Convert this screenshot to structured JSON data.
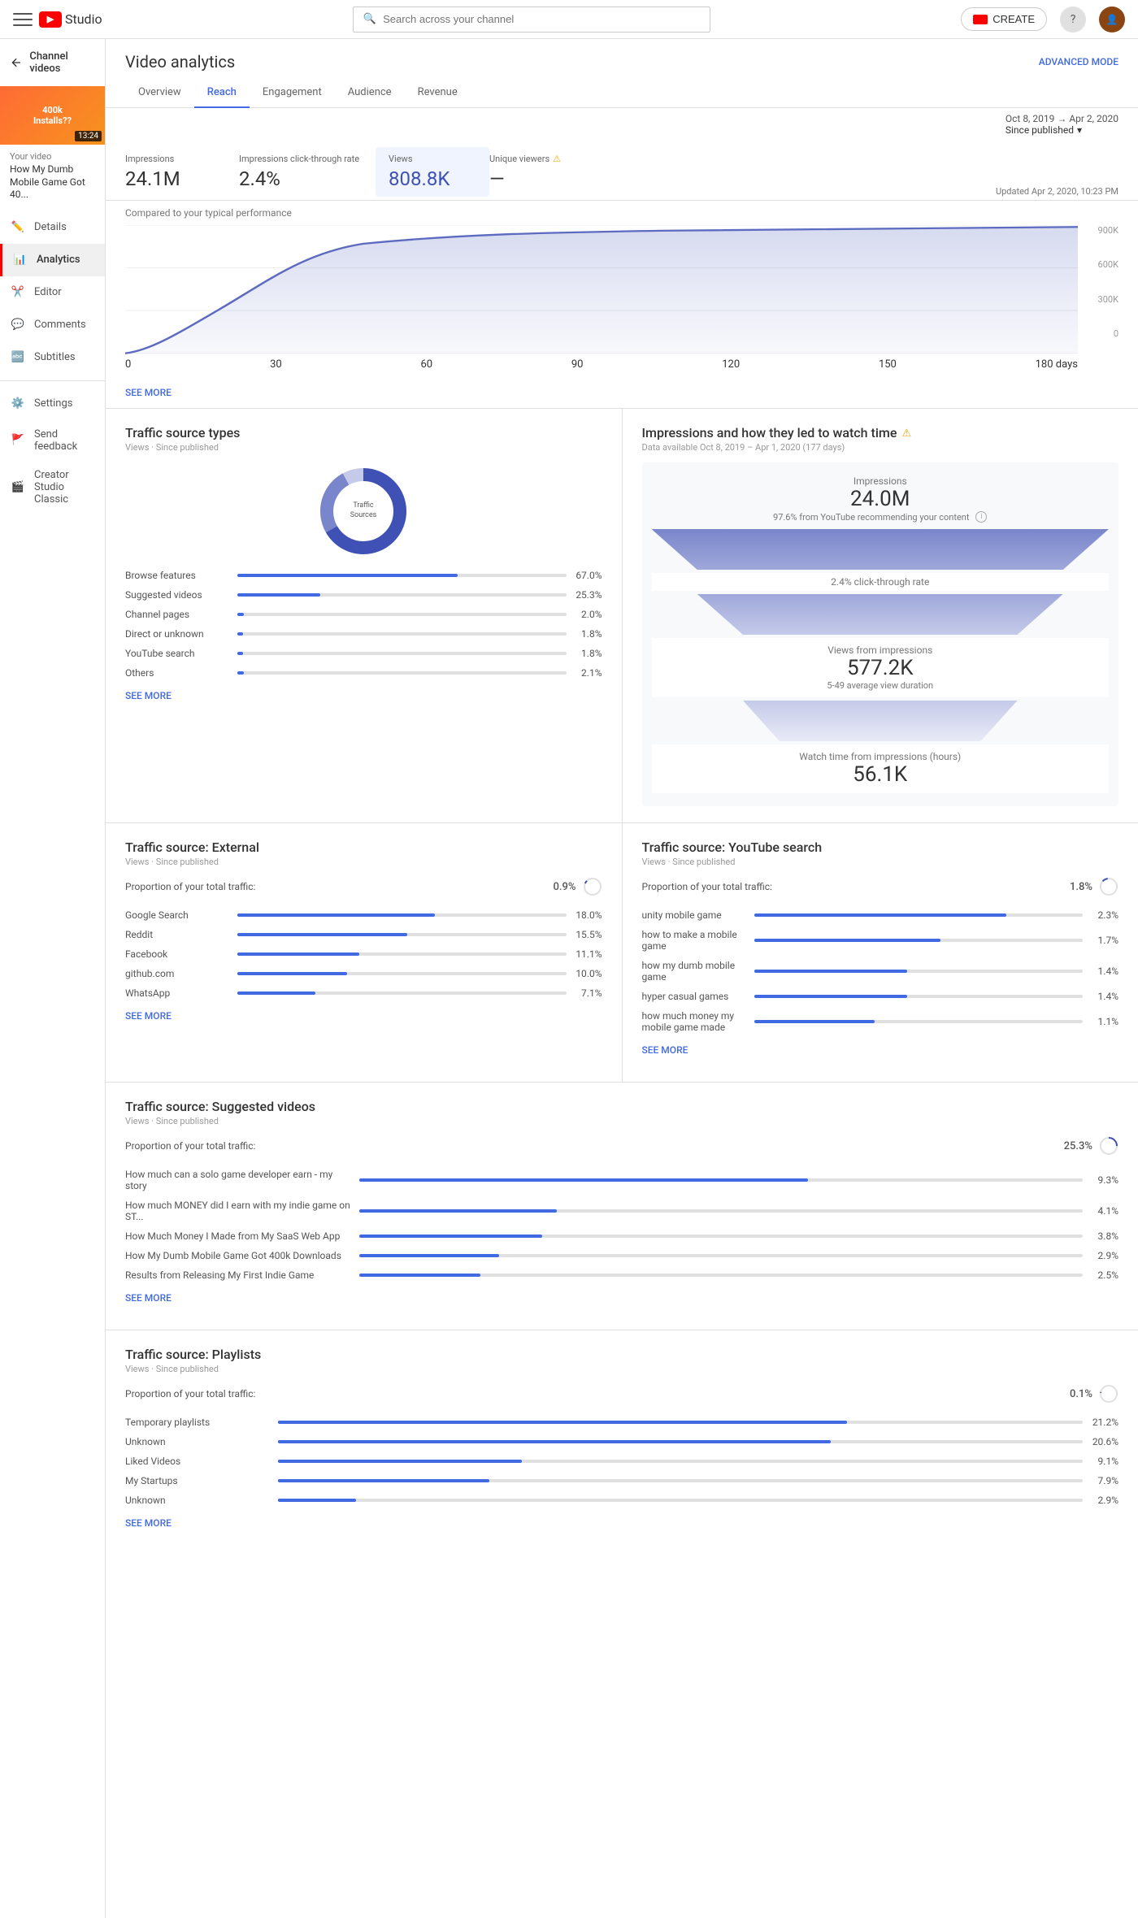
{
  "topnav": {
    "logo_text": "Studio",
    "search_placeholder": "Search across your channel",
    "create_label": "CREATE"
  },
  "sidebar": {
    "back_label": "Channel videos",
    "video": {
      "title": "How My Dumb Mobile Game Got 40...",
      "label": "Your video",
      "duration": "13:24",
      "badge": "400k\nInstalls??"
    },
    "items": [
      {
        "icon": "pencil-icon",
        "label": "Details"
      },
      {
        "icon": "analytics-icon",
        "label": "Analytics",
        "active": true
      },
      {
        "icon": "editor-icon",
        "label": "Editor"
      },
      {
        "icon": "comments-icon",
        "label": "Comments"
      },
      {
        "icon": "subtitles-icon",
        "label": "Subtitles"
      },
      {
        "icon": "settings-icon",
        "label": "Settings"
      },
      {
        "icon": "feedback-icon",
        "label": "Send feedback"
      },
      {
        "icon": "classic-icon",
        "label": "Creator Studio Classic"
      }
    ]
  },
  "page": {
    "title": "Video analytics",
    "advanced_mode": "ADVANCED MODE"
  },
  "tabs": [
    "Overview",
    "Reach",
    "Engagement",
    "Audience",
    "Revenue"
  ],
  "active_tab": "Reach",
  "date_range": {
    "range": "Oct 8, 2019 → Apr 2, 2020",
    "period": "Since published"
  },
  "metrics": {
    "impressions": {
      "label": "Impressions",
      "value": "24.1M"
    },
    "ctr": {
      "label": "Impressions click-through rate",
      "value": "2.4%"
    },
    "views": {
      "label": "Views",
      "value": "808.8K"
    },
    "unique_viewers": {
      "label": "Unique viewers",
      "value": "—"
    },
    "updated": "Updated Apr 2, 2020, 10:23 PM"
  },
  "chart": {
    "subtitle": "Compared to your typical performance",
    "y_labels": [
      "900K",
      "600K",
      "300K",
      "0"
    ],
    "x_labels": [
      "0",
      "30",
      "60",
      "90",
      "120",
      "150",
      "180 days"
    ]
  },
  "traffic_sources": {
    "title": "Traffic source types",
    "subtitle": "Views · Since published",
    "donut_label": "Traffic\nSources",
    "items": [
      {
        "label": "Browse features",
        "pct": "67.0%",
        "fill": 67
      },
      {
        "label": "Suggested videos",
        "pct": "25.3%",
        "fill": 25.3
      },
      {
        "label": "Channel pages",
        "pct": "2.0%",
        "fill": 2
      },
      {
        "label": "Direct or unknown",
        "pct": "1.8%",
        "fill": 1.8
      },
      {
        "label": "YouTube search",
        "pct": "1.8%",
        "fill": 1.8
      },
      {
        "label": "Others",
        "pct": "2.1%",
        "fill": 2.1
      }
    ],
    "see_more": "SEE MORE"
  },
  "funnel": {
    "title": "Impressions and how they led to watch time",
    "info": true,
    "subtitle": "Data available Oct 8, 2019 – Apr 1, 2020 (177 days)",
    "steps": [
      {
        "label": "Impressions",
        "value": "24.0M",
        "note": "97.6% from YouTube recommending your content"
      },
      {
        "label": "2.4% click-through rate",
        "value": null,
        "note": null
      },
      {
        "label": "Views from impressions",
        "value": "577.2K",
        "note": "5-49 average view duration"
      },
      {
        "label": "Watch time from impressions (hours)",
        "value": "56.1K",
        "note": null
      }
    ]
  },
  "external_traffic": {
    "title": "Traffic source: External",
    "subtitle": "Views · Since published",
    "proportion_label": "Proportion of your total traffic:",
    "proportion_val": "0.9%",
    "items": [
      {
        "label": "Google Search",
        "pct": "18.0%",
        "fill": 18
      },
      {
        "label": "Reddit",
        "pct": "15.5%",
        "fill": 15.5
      },
      {
        "label": "Facebook",
        "pct": "11.1%",
        "fill": 11.1
      },
      {
        "label": "github.com",
        "pct": "10.0%",
        "fill": 10
      },
      {
        "label": "WhatsApp",
        "pct": "7.1%",
        "fill": 7.1
      }
    ],
    "see_more": "SEE MORE"
  },
  "yt_search": {
    "title": "Traffic source: YouTube search",
    "subtitle": "Views · Since published",
    "proportion_label": "Proportion of your total traffic:",
    "proportion_val": "1.8%",
    "items": [
      {
        "label": "unity mobile game",
        "pct": "2.3%",
        "fill": 2.3
      },
      {
        "label": "how to make a mobile game",
        "pct": "1.7%",
        "fill": 1.7
      },
      {
        "label": "how my dumb mobile game",
        "pct": "1.4%",
        "fill": 1.4
      },
      {
        "label": "hyper casual games",
        "pct": "1.4%",
        "fill": 1.4
      },
      {
        "label": "how much money my mobile game made",
        "pct": "1.1%",
        "fill": 1.1
      }
    ],
    "see_more": "SEE MORE"
  },
  "suggested_videos": {
    "title": "Traffic source: Suggested videos",
    "subtitle": "Views · Since published",
    "proportion_label": "Proportion of your total traffic:",
    "proportion_val": "25.3%",
    "items": [
      {
        "label": "How much can a solo game developer earn - my story",
        "pct": "9.3%",
        "fill": 9.3
      },
      {
        "label": "How much MONEY did I earn with my indie game on ST...",
        "pct": "4.1%",
        "fill": 4.1
      },
      {
        "label": "How Much Money I Made from My SaaS Web App",
        "pct": "3.8%",
        "fill": 3.8
      },
      {
        "label": "How My Dumb Mobile Game Got 400k Downloads",
        "pct": "2.9%",
        "fill": 2.9
      },
      {
        "label": "Results from Releasing My First Indie Game",
        "pct": "2.5%",
        "fill": 2.5
      }
    ],
    "see_more": "SEE MORE"
  },
  "playlists": {
    "title": "Traffic source: Playlists",
    "subtitle": "Views · Since published",
    "proportion_label": "Proportion of your total traffic:",
    "proportion_val": "0.1%",
    "items": [
      {
        "label": "Temporary playlists",
        "pct": "21.2%",
        "fill": 21.2
      },
      {
        "label": "Unknown",
        "pct": "20.6%",
        "fill": 20.6
      },
      {
        "label": "Liked Videos",
        "pct": "9.1%",
        "fill": 9.1
      },
      {
        "label": "My Startups",
        "pct": "7.9%",
        "fill": 7.9
      },
      {
        "label": "Unknown",
        "pct": "2.9%",
        "fill": 2.9
      }
    ],
    "see_more": "SEE MORE"
  }
}
